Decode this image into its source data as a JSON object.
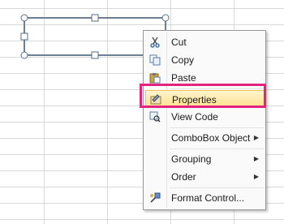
{
  "menu": {
    "items": [
      {
        "label": "Cut",
        "icon": "scissors-icon"
      },
      {
        "label": "Copy",
        "icon": "copy-icon"
      },
      {
        "label": "Paste",
        "icon": "paste-icon"
      },
      {
        "label": "Properties",
        "icon": "properties-icon"
      },
      {
        "label": "View Code",
        "icon": "view-code-icon"
      },
      {
        "label": "ComboBox Object",
        "icon": "",
        "submenu_arrow": "▶"
      },
      {
        "label": "Grouping",
        "icon": "",
        "submenu_arrow": "▶"
      },
      {
        "label": "Order",
        "icon": "",
        "submenu_arrow": "▶"
      },
      {
        "label": "Format Control...",
        "icon": "format-control-icon"
      }
    ]
  },
  "colors": {
    "highlight_box": "#e2237f",
    "selection_fill": "#ffe18e",
    "handle_fill": "#ffffff"
  }
}
